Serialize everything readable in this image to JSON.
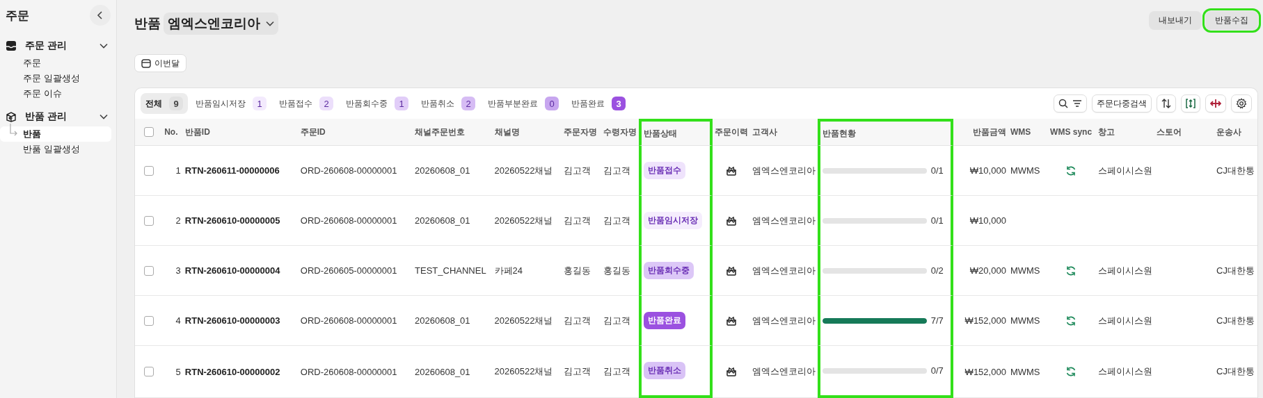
{
  "sidebar": {
    "title": "주문",
    "groups": [
      {
        "label": "주문 관리",
        "expanded": true,
        "items": [
          {
            "label": "주문",
            "selected": false
          },
          {
            "label": "주문 일괄생성",
            "selected": false
          },
          {
            "label": "주문 이슈",
            "selected": false
          }
        ]
      },
      {
        "label": "반품 관리",
        "expanded": true,
        "items": [
          {
            "label": "반품",
            "selected": true
          },
          {
            "label": "반품 일괄생성",
            "selected": false
          }
        ]
      }
    ]
  },
  "header": {
    "title": "반품",
    "company": "엠엑스엔코리아",
    "buttons": [
      {
        "label": "내보내기",
        "highlighted": false
      },
      {
        "label": "반품수집",
        "highlighted": true
      }
    ],
    "date_filter": "이번달"
  },
  "tabs": [
    {
      "label": "전체",
      "count": "9",
      "selected": true,
      "color": "#e2e2e2"
    },
    {
      "label": "반품임시저장",
      "count": "1",
      "selected": false,
      "color": "#f3eafd"
    },
    {
      "label": "반품접수",
      "count": "2",
      "selected": false,
      "color": "#ecdffb"
    },
    {
      "label": "반품회수중",
      "count": "1",
      "selected": false,
      "color": "#e1cdf8"
    },
    {
      "label": "반품취소",
      "count": "2",
      "selected": false,
      "color": "#d6bcf4"
    },
    {
      "label": "반품부분완료",
      "count": "0",
      "selected": false,
      "color": "#c7a6ef"
    },
    {
      "label": "반품완료",
      "count": "3",
      "selected": false,
      "color": "#9b51e0"
    }
  ],
  "toolbar": {
    "multi_search": "주문다중검색"
  },
  "table": {
    "select_all": {
      "checked": false
    },
    "columns": [
      {
        "label": "No.",
        "highlighted": false
      },
      {
        "label": "반품ID",
        "highlighted": false
      },
      {
        "label": "주문ID",
        "highlighted": false
      },
      {
        "label": "채널주문번호",
        "highlighted": false
      },
      {
        "label": "채널명",
        "highlighted": false
      },
      {
        "label": "주문자명",
        "highlighted": false
      },
      {
        "label": "수령자명",
        "highlighted": false
      },
      {
        "label": "반품상태",
        "highlighted": true
      },
      {
        "label": "주문이력",
        "highlighted": false
      },
      {
        "label": "고객사",
        "highlighted": false
      },
      {
        "label": "반품현황",
        "highlighted": true
      },
      {
        "label": "반품금액",
        "highlighted": false
      },
      {
        "label": "WMS",
        "highlighted": false
      },
      {
        "label": "WMS sync",
        "highlighted": false
      },
      {
        "label": "창고",
        "highlighted": false
      },
      {
        "label": "스토어",
        "highlighted": false
      },
      {
        "label": "운송사",
        "highlighted": false
      }
    ],
    "rows": [
      {
        "checked": false,
        "no": "1",
        "return_id": "RTN-260611-00000006",
        "order_id": "ORD-260608-00000001",
        "channel_order_no": "20260608_01",
        "channel_name": "20260522채널",
        "orderer": "김고객",
        "receiver": "김고객",
        "status": {
          "label": "반품접수",
          "color": "#efe3fc"
        },
        "customer": "엠엑스엔코리아",
        "progress": {
          "level": 0,
          "reading": "0/1"
        },
        "amount": "₩10,000",
        "wms": "MWMS",
        "wms_sync": true,
        "warehouse": "스페이시스원",
        "carrier": "CJ대한통"
      },
      {
        "checked": false,
        "no": "2",
        "return_id": "RTN-260610-00000005",
        "order_id": "ORD-260608-00000001",
        "channel_order_no": "20260608_01",
        "channel_name": "20260522채널",
        "orderer": "김고객",
        "receiver": "김고객",
        "status": {
          "label": "반품임시저장",
          "color": "#f5edfd"
        },
        "customer": "엠엑스엔코리아",
        "progress": {
          "level": 0,
          "reading": "0/1"
        },
        "amount": "₩10,000",
        "wms_sync": false
      },
      {
        "checked": false,
        "no": "3",
        "return_id": "RTN-260610-00000004",
        "order_id": "ORD-260605-00000001",
        "channel_order_no": "TEST_CHANNEL",
        "channel_name": "카페24",
        "orderer": "홍길동",
        "receiver": "홍길동",
        "status": {
          "label": "반품회수중",
          "color": "#dcc7f7"
        },
        "customer": "엠엑스엔코리아",
        "progress": {
          "level": 0,
          "reading": "0/2"
        },
        "amount": "₩20,000",
        "wms": "MWMS",
        "wms_sync": true,
        "warehouse": "스페이시스원",
        "carrier": "CJ대한통"
      },
      {
        "checked": false,
        "no": "4",
        "return_id": "RTN-260610-00000003",
        "order_id": "ORD-260608-00000001",
        "channel_order_no": "20260608_01",
        "channel_name": "20260522채널",
        "orderer": "김고객",
        "receiver": "김고객",
        "status": {
          "label": "반품완료",
          "color": "#9b51e0"
        },
        "customer": "엠엑스엔코리아",
        "progress": {
          "level": 1,
          "reading": "7/7"
        },
        "amount": "₩152,000",
        "wms": "MWMS",
        "wms_sync": true,
        "warehouse": "스페이시스원",
        "carrier": "CJ대한통"
      },
      {
        "checked": false,
        "no": "5",
        "return_id": "RTN-260610-00000002",
        "order_id": "ORD-260608-00000001",
        "channel_order_no": "20260608_01",
        "channel_name": "20260522채널",
        "orderer": "김고객",
        "receiver": "김고객",
        "status": {
          "label": "반품취소",
          "color": "#d9c3f6"
        },
        "customer": "엠엑스엔코리아",
        "progress": {
          "level": 0,
          "reading": "0/7"
        },
        "amount": "₩152,000",
        "wms": "MWMS",
        "wms_sync": true,
        "warehouse": "스페이시스원",
        "carrier": "CJ대한통"
      }
    ]
  }
}
